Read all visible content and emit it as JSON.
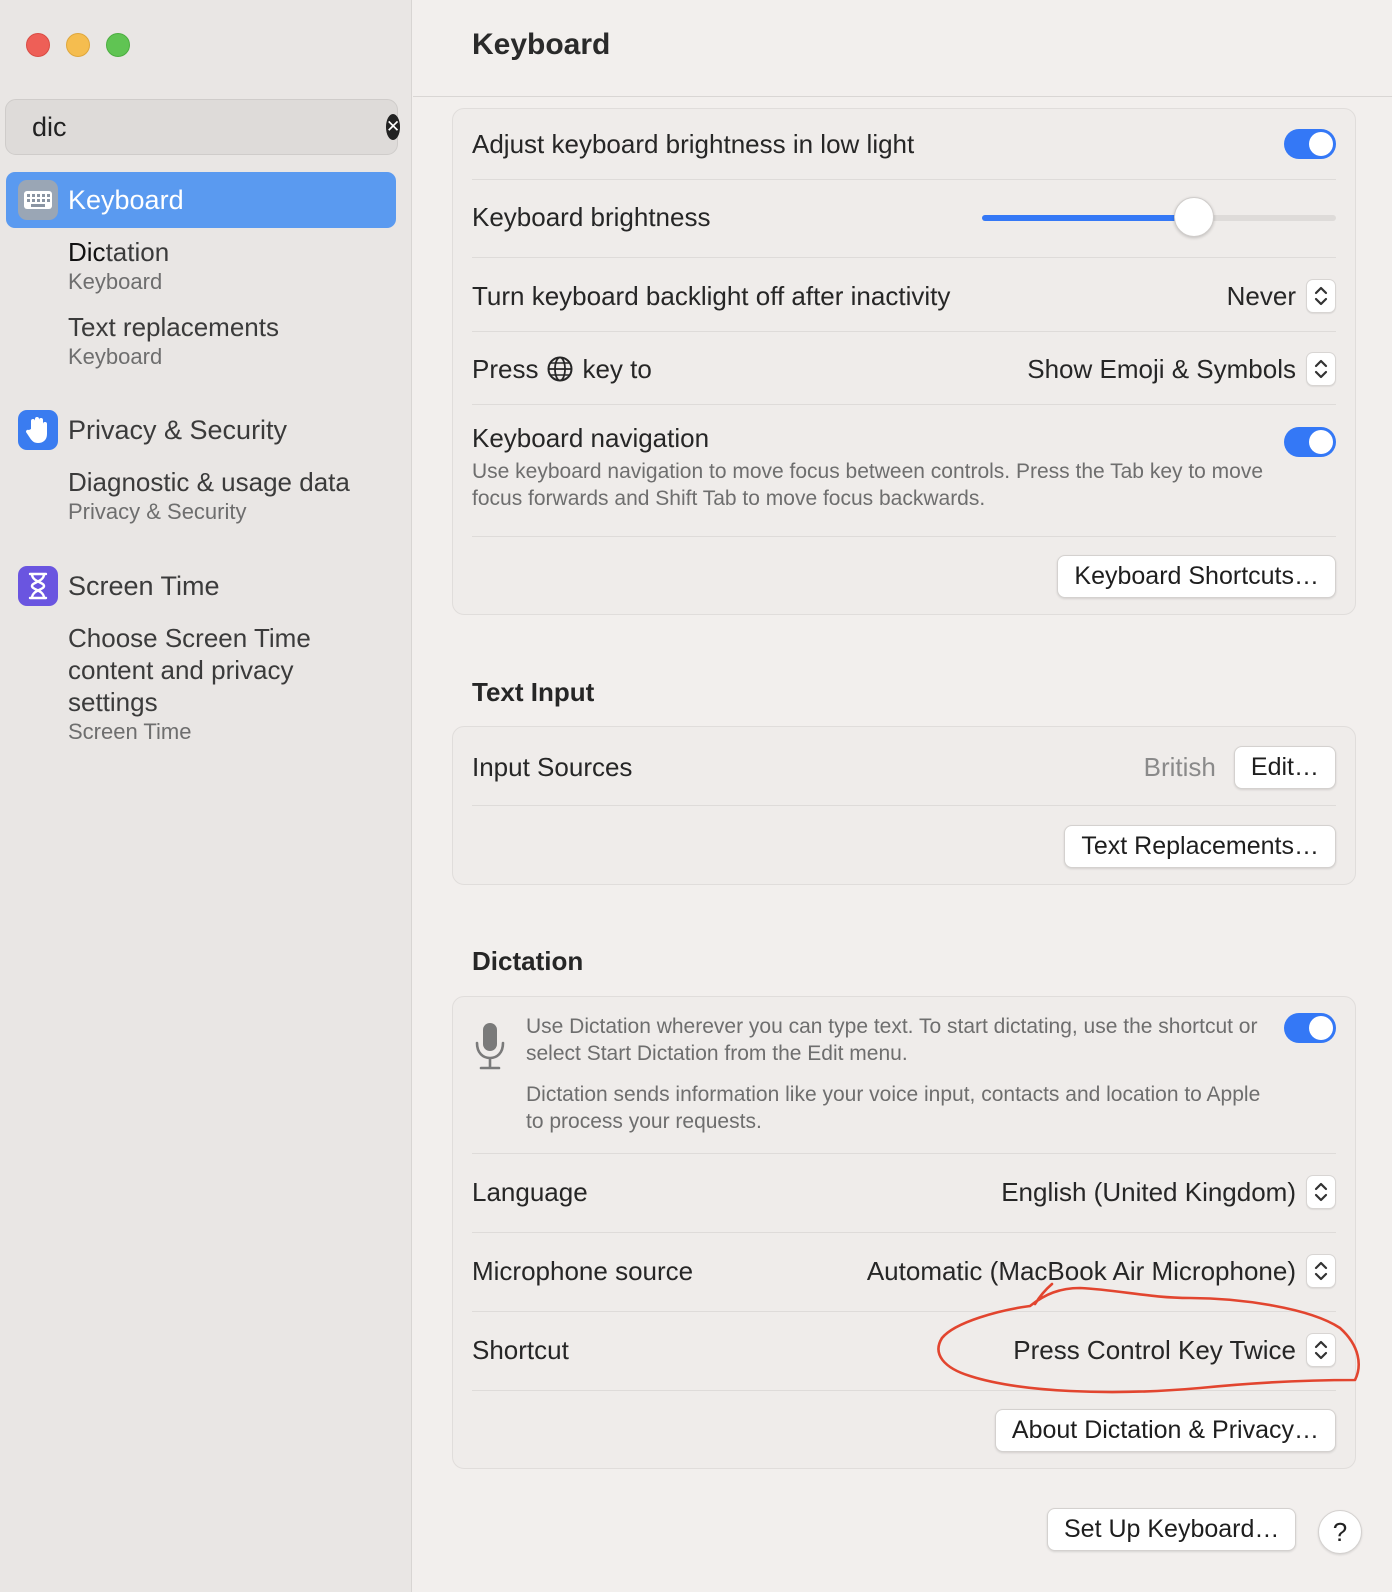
{
  "sidebar": {
    "search": {
      "value": "dic",
      "placeholder": "Search"
    },
    "results": [
      {
        "label": "Keyboard",
        "icon": "keyboard-icon",
        "active": true
      },
      {
        "label_match": "Dic",
        "label_rest": "tation",
        "sub": "Keyboard"
      },
      {
        "label": "Text replacements",
        "sub": "Keyboard"
      },
      {
        "label": "Privacy & Security",
        "icon": "hand-icon"
      },
      {
        "label": "Diagnostic & usage data",
        "sub": "Privacy & Security"
      },
      {
        "label": "Screen Time",
        "icon": "hourglass-icon"
      },
      {
        "label": "Choose Screen Time content and privacy settings",
        "sub": "Screen Time"
      }
    ]
  },
  "header": {
    "title": "Keyboard"
  },
  "keyboard_card": {
    "adjust_brightness_label": "Adjust keyboard brightness in low light",
    "adjust_brightness_on": true,
    "brightness_label": "Keyboard brightness",
    "brightness_level": 0.6,
    "backlight_label": "Turn keyboard backlight off after inactivity",
    "backlight_value": "Never",
    "press_key_label_before": "Press",
    "press_key_label_after": "key to",
    "press_key_value": "Show Emoji & Symbols",
    "nav_label": "Keyboard navigation",
    "nav_desc": "Use keyboard navigation to move focus between controls. Press the Tab key to move focus forwards and Shift Tab to move focus backwards.",
    "nav_on": true,
    "shortcuts_button": "Keyboard Shortcuts…"
  },
  "text_input": {
    "section_title": "Text Input",
    "input_sources_label": "Input Sources",
    "input_sources_value": "British",
    "edit_button": "Edit…",
    "text_replacements_button": "Text Replacements…"
  },
  "dictation": {
    "section_title": "Dictation",
    "desc1": "Use Dictation wherever you can type text. To start dictating, use the shortcut or select Start Dictation from the Edit menu.",
    "desc2": "Dictation sends information like your voice input, contacts and location to Apple to process your requests.",
    "enabled": true,
    "language_label": "Language",
    "language_value": "English (United Kingdom)",
    "mic_label": "Microphone source",
    "mic_value": "Automatic (MacBook Air Microphone)",
    "shortcut_label": "Shortcut",
    "shortcut_value": "Press Control Key Twice",
    "about_button": "About Dictation & Privacy…"
  },
  "footer": {
    "setup_button": "Set Up Keyboard…",
    "help_button": "?"
  },
  "colors": {
    "accent": "#3478f6",
    "sidebar_selection": "#5a9af0",
    "annotation": "#e2452f"
  }
}
